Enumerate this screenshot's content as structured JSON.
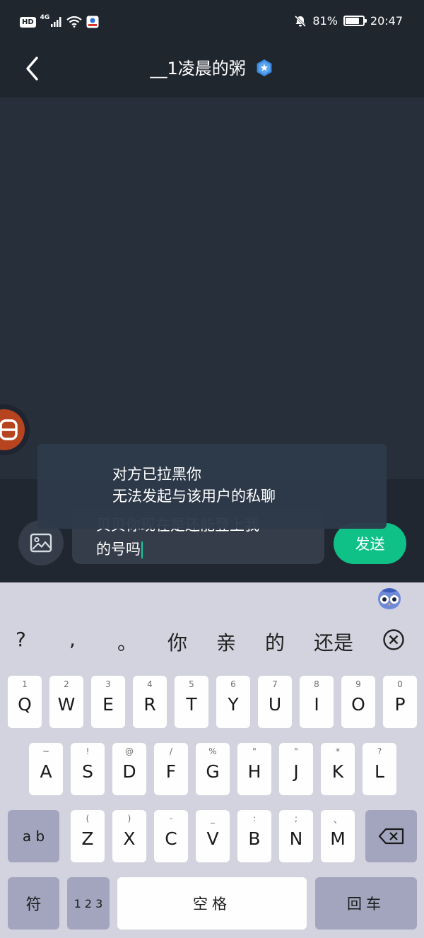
{
  "status_bar": {
    "hd": "HD",
    "network": "4G",
    "battery_percent": "81%",
    "battery_level": 0.81,
    "time": "20:47"
  },
  "header": {
    "title": "__1凌晨的粥"
  },
  "input": {
    "value_line1": "贝贝你现在是还能登上我",
    "value_line2": "的号吗",
    "send_label": "发送"
  },
  "toast": {
    "line1": "对方已拉黑你",
    "line2": "无法发起与该用户的私聊"
  },
  "keyboard": {
    "candidates": [
      "?",
      ",",
      "。",
      "你",
      "亲",
      "的",
      "还是"
    ],
    "row1": [
      {
        "hint": "1",
        "key": "Q"
      },
      {
        "hint": "2",
        "key": "W"
      },
      {
        "hint": "3",
        "key": "E"
      },
      {
        "hint": "4",
        "key": "R"
      },
      {
        "hint": "5",
        "key": "T"
      },
      {
        "hint": "6",
        "key": "Y"
      },
      {
        "hint": "7",
        "key": "U"
      },
      {
        "hint": "8",
        "key": "I"
      },
      {
        "hint": "9",
        "key": "O"
      },
      {
        "hint": "0",
        "key": "P"
      }
    ],
    "row2": [
      {
        "hint": "~",
        "key": "A"
      },
      {
        "hint": "!",
        "key": "S"
      },
      {
        "hint": "@",
        "key": "D"
      },
      {
        "hint": "/",
        "key": "F"
      },
      {
        "hint": "%",
        "key": "G"
      },
      {
        "hint": "\"",
        "key": "H"
      },
      {
        "hint": "\"",
        "key": "J"
      },
      {
        "hint": "*",
        "key": "K"
      },
      {
        "hint": "?",
        "key": "L"
      }
    ],
    "row3": [
      {
        "hint": "(",
        "key": "Z"
      },
      {
        "hint": ")",
        "key": "X"
      },
      {
        "hint": "-",
        "key": "C"
      },
      {
        "hint": "_",
        "key": "V"
      },
      {
        "hint": ":",
        "key": "B"
      },
      {
        "hint": ";",
        "key": "N"
      },
      {
        "hint": "、",
        "key": "M"
      }
    ],
    "ab_label": "a b",
    "symbol_label": "符",
    "num_label": "1 2 3",
    "space_label": "空格",
    "enter_label": "回车"
  }
}
